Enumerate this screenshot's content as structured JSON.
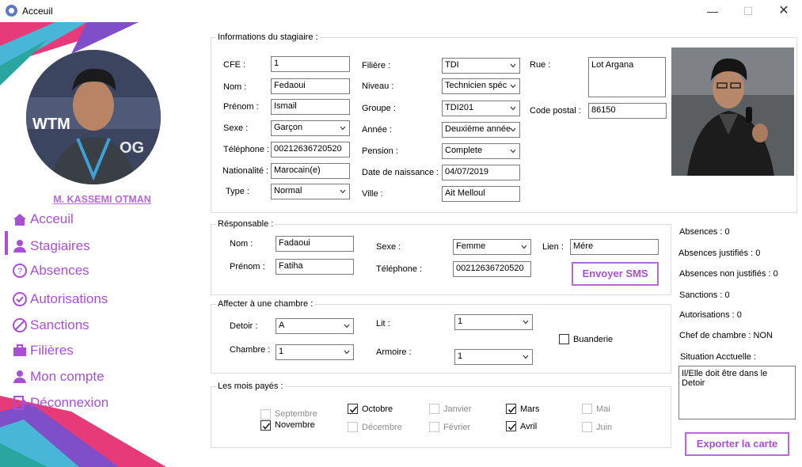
{
  "window": {
    "title": "Acceuil"
  },
  "user": {
    "name": "M. KASSEMI OTMAN"
  },
  "nav": [
    {
      "label": "Acceuil",
      "icon": "home-icon"
    },
    {
      "label": "Stagiaires",
      "icon": "user-icon"
    },
    {
      "label": "Absences",
      "icon": "question-circle-icon"
    },
    {
      "label": "Autorisations",
      "icon": "check-circle-icon"
    },
    {
      "label": "Sanctions",
      "icon": "slash-circle-icon"
    },
    {
      "label": "Filières",
      "icon": "briefcase-icon"
    },
    {
      "label": "Mon compte",
      "icon": "account-icon"
    },
    {
      "label": "Déconnexion",
      "icon": "logout-icon"
    }
  ],
  "stagiaire": {
    "group_label": "Informations du stagiaire :",
    "cfe_label": "CFE :",
    "cfe": "1",
    "nom_label": "Nom :",
    "nom": "Fedaoui",
    "prenom_label": "Prénom :",
    "prenom": "Ismail",
    "sexe_label": "Sexe :",
    "sexe": "Garçon",
    "telephone_label": "Téléphone :",
    "telephone": "00212636720520",
    "nationalite_label": "Nationalité :",
    "nationalite": "Marocain(e)",
    "type_label": "Type :",
    "type": "Normal",
    "filiere_label": "Filière :",
    "filiere": "TDI",
    "niveau_label": "Niveau :",
    "niveau": "Technicien spéc",
    "groupe_label": "Groupe :",
    "groupe": "TDI201",
    "annee_label": "Année :",
    "annee": "Deuxième année",
    "pension_label": "Pension :",
    "pension": "Complete",
    "naissance_label": "Date de naissance :",
    "naissance": "04/07/2019",
    "ville_label": "Ville :",
    "ville": "Ait Melloul",
    "rue_label": "Rue :",
    "rue": "Lot Argana",
    "code_postal_label": "Code postal :",
    "code_postal": "86150"
  },
  "responsable": {
    "group_label": "Résponsable :",
    "nom_label": "Nom :",
    "nom": "Fadaoui",
    "prenom_label": "Prénom :",
    "prenom": "Fatiha",
    "sexe_label": "Sexe :",
    "sexe": "Femme",
    "telephone_label": "Téléphone :",
    "telephone": "00212636720520",
    "lien_label": "Lien :",
    "lien": "Mére",
    "sms_button": "Envoyer SMS"
  },
  "chambre": {
    "group_label": "Affecter à une chambre :",
    "detoir_label": "Detoir :",
    "detoir": "A",
    "chambre_label": "Chambre :",
    "chambre": "1",
    "lit_label": "Lit :",
    "lit": "1",
    "armoire_label": "Armoire :",
    "armoire": "1",
    "buanderie_label": "Buanderie"
  },
  "mois": {
    "group_label": "Les mois payés :",
    "items": [
      {
        "label": "Septembre",
        "checked": false,
        "enabled": false
      },
      {
        "label": "Novembre",
        "checked": true,
        "enabled": true
      },
      {
        "label": "Octobre",
        "checked": true,
        "enabled": true
      },
      {
        "label": "Décembre",
        "checked": false,
        "enabled": false
      },
      {
        "label": "Janvier",
        "checked": false,
        "enabled": false
      },
      {
        "label": "Février",
        "checked": false,
        "enabled": false
      },
      {
        "label": "Mars",
        "checked": true,
        "enabled": true
      },
      {
        "label": "Avril",
        "checked": true,
        "enabled": true
      },
      {
        "label": "Mai",
        "checked": false,
        "enabled": false
      },
      {
        "label": "Juin",
        "checked": false,
        "enabled": false
      }
    ]
  },
  "stats": {
    "absences": "Absences : 0",
    "absences_justifies": "Absences justifiés : 0",
    "absences_non_justifies": "Absences non justifiés : 0",
    "sanctions": "Sanctions : 0",
    "autorisations": "Autorisations : 0",
    "chef_chambre": "Chef de chambre : NON",
    "situation_label": "Situation Acctuelle :",
    "situation": "Il/Elle doit être dans le Detoir",
    "export_button": "Exporter la carte"
  },
  "colors": {
    "accent": "#a94fd3",
    "accent_light": "#b56ad6"
  }
}
